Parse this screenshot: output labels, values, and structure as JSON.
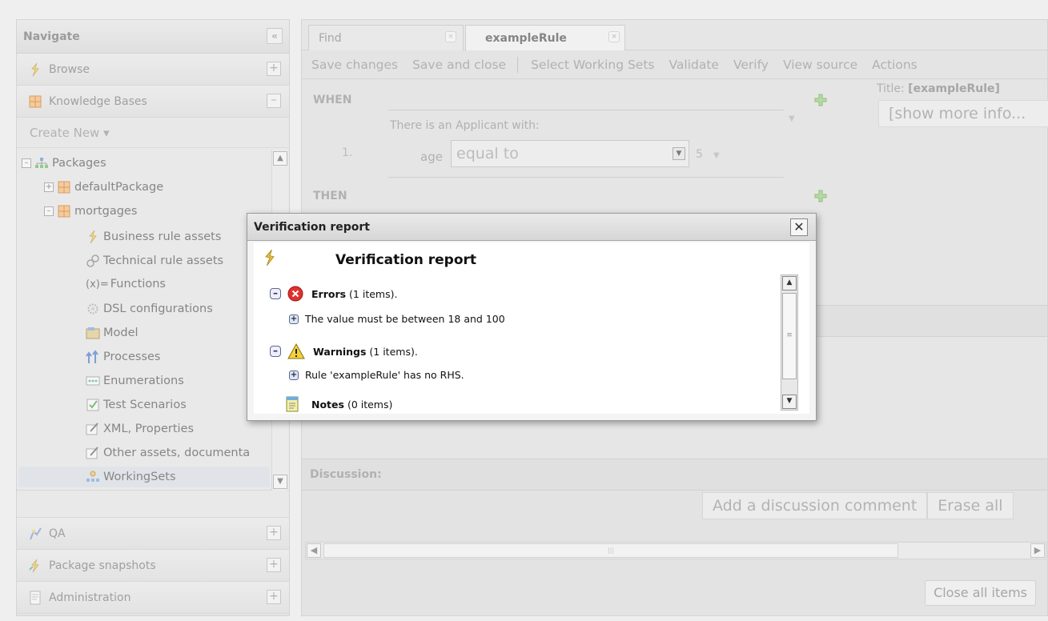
{
  "nav": {
    "header": "Navigate",
    "collapse_label": "«",
    "sections_top": [
      {
        "label": "Browse",
        "toggle": "+"
      },
      {
        "label": "Knowledge Bases",
        "toggle": "–"
      }
    ],
    "create_new": "Create New ▾",
    "tree": [
      {
        "label": "Packages",
        "exp": "–"
      },
      {
        "label": "defaultPackage",
        "exp": "+"
      },
      {
        "label": "mortgages",
        "exp": "–"
      },
      {
        "label": "Business rule assets"
      },
      {
        "label": "Technical rule assets"
      },
      {
        "label": "Functions",
        "prefix": "(x)="
      },
      {
        "label": "DSL configurations"
      },
      {
        "label": "Model"
      },
      {
        "label": "Processes"
      },
      {
        "label": "Enumerations"
      },
      {
        "label": "Test Scenarios"
      },
      {
        "label": "XML, Properties"
      },
      {
        "label": "Other assets, documenta"
      },
      {
        "label": "WorkingSets"
      }
    ],
    "sections_bottom": [
      {
        "label": "QA",
        "toggle": "+"
      },
      {
        "label": "Package snapshots",
        "toggle": "+"
      },
      {
        "label": "Administration",
        "toggle": "+"
      }
    ]
  },
  "tabs": [
    {
      "label": "Find",
      "close": "×"
    },
    {
      "label": "exampleRule",
      "close": "×"
    }
  ],
  "toolbar": {
    "save_changes": "Save changes",
    "save_close": "Save and close",
    "select_ws": "Select Working Sets",
    "validate": "Validate",
    "verify": "Verify",
    "view_source": "View source",
    "actions": "Actions"
  },
  "editor": {
    "when": "WHEN",
    "then": "THEN",
    "applicant": "There is an Applicant with:",
    "row_num": "1.",
    "field": "age",
    "operator": "equal to",
    "value": "5",
    "title_prefix": "Title: ",
    "title_value": "[exampleRule]",
    "more_info": "[show more info..."
  },
  "discussion": {
    "header": "Discussion:",
    "add": "Add a discussion comment",
    "erase": "Erase all"
  },
  "close_all": "Close all items",
  "dialog": {
    "title": "Verification report",
    "heading": "Verification report",
    "errors_label": "Errors",
    "errors_count": "(1 items).",
    "error_item": "The value must be between 18 and 100",
    "warnings_label": "Warnings",
    "warnings_count": "(1 items).",
    "warning_item": "Rule 'exampleRule' has no RHS.",
    "notes_label": "Notes",
    "notes_count": "(0 items)"
  }
}
